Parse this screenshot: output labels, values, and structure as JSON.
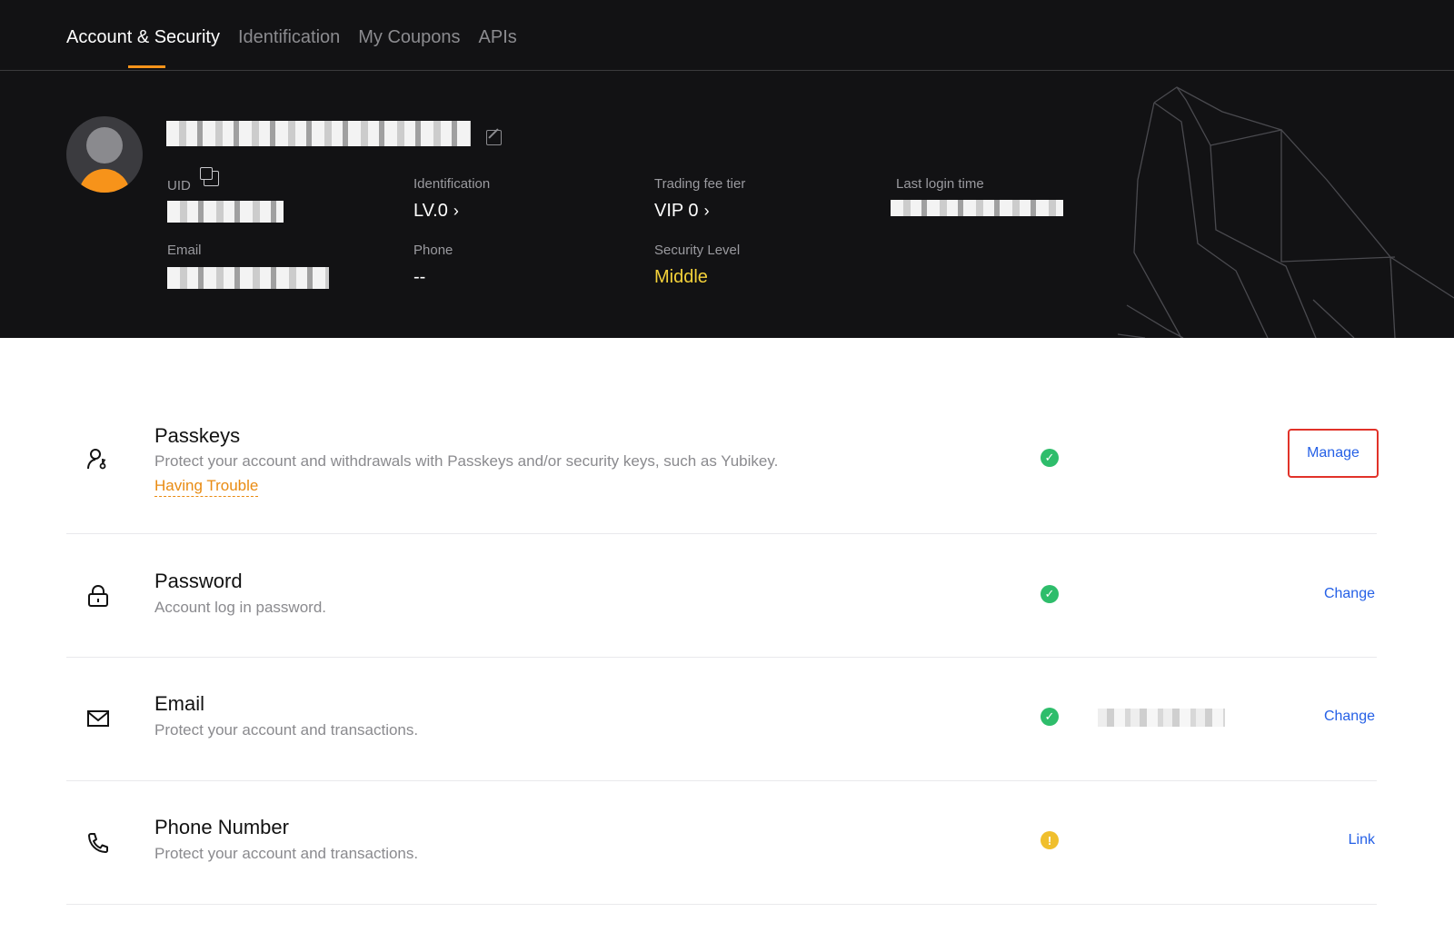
{
  "tabs": [
    {
      "label": "Account & Security",
      "active": true
    },
    {
      "label": "Identification",
      "active": false
    },
    {
      "label": "My Coupons",
      "active": false
    },
    {
      "label": "APIs",
      "active": false
    }
  ],
  "profile": {
    "uid_label": "UID",
    "identification_label": "Identification",
    "identification_value": "LV.0",
    "trading_fee_label": "Trading fee tier",
    "trading_fee_value": "VIP 0",
    "last_login_label": "Last login time",
    "email_label": "Email",
    "phone_label": "Phone",
    "phone_value": "--",
    "security_level_label": "Security Level",
    "security_level_value": "Middle"
  },
  "security_items": [
    {
      "title": "Passkeys",
      "description": "Protect your account and withdrawals with Passkeys and/or security keys, such as Yubikey.",
      "link": "Having Trouble",
      "status": "ok",
      "action": "Manage",
      "icon": "user-key-icon"
    },
    {
      "title": "Password",
      "description": "Account log in password.",
      "status": "ok",
      "action": "Change",
      "icon": "lock-icon"
    },
    {
      "title": "Email",
      "description": "Protect your account and transactions.",
      "status": "ok",
      "action": "Change",
      "icon": "mail-icon"
    },
    {
      "title": "Phone Number",
      "description": "Protect your account and transactions.",
      "status": "warn",
      "action": "Link",
      "icon": "phone-icon"
    }
  ],
  "colors": {
    "accent": "#f7931a",
    "link_blue": "#2560e6",
    "success": "#2ebd6b",
    "warning": "#f0bf2d",
    "security_middle": "#f5d23a"
  }
}
